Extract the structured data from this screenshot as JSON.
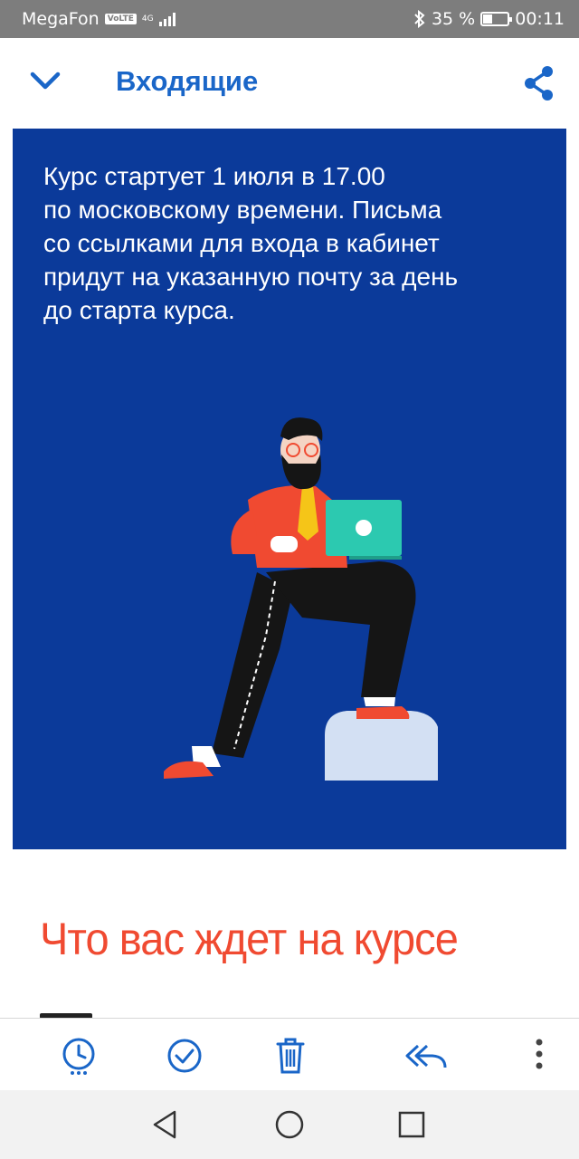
{
  "status_bar": {
    "carrier": "MegaFon",
    "volte": "VoLTE",
    "network": "4G",
    "battery_percent": "35 %",
    "time": "00:11"
  },
  "header": {
    "title": "Входящие",
    "back_icon": "chevron-down-icon",
    "share_icon": "share-icon"
  },
  "banner": {
    "text": "Курс стартует 1 июля в 17.00\nпо московскому времени. Письма\nсо ссылками для входа в кабинет\nпридут на указанную почту за день\nдо старта курса.",
    "background": "#0b3a9a"
  },
  "section": {
    "heading": "Что вас ждет на курсе",
    "heading_color": "#f04a31"
  },
  "toolbar": {
    "items": [
      "snooze-icon",
      "mark-done-icon",
      "trash-icon",
      "reply-all-icon",
      "more-vert-icon"
    ],
    "accent": "#1a66c8"
  },
  "nav_bar": {
    "items": [
      "back-triangle-icon",
      "home-circle-icon",
      "recents-square-icon"
    ]
  }
}
